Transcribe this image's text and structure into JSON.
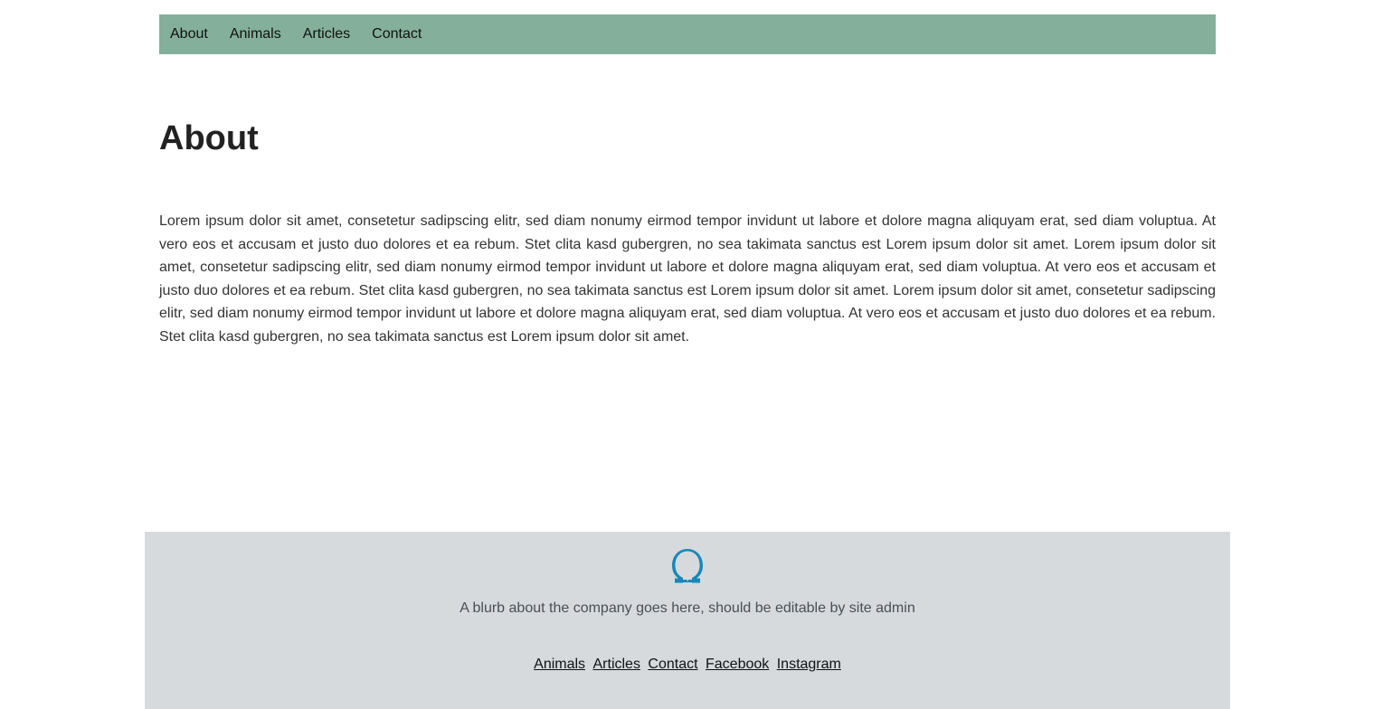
{
  "nav": {
    "items": [
      {
        "label": "About"
      },
      {
        "label": "Animals"
      },
      {
        "label": "Articles"
      },
      {
        "label": "Contact"
      }
    ]
  },
  "main": {
    "title": "About",
    "paragraph": "Lorem ipsum dolor sit amet, consetetur sadipscing elitr, sed diam nonumy eirmod tempor invidunt ut labore et dolore magna aliquyam erat, sed diam voluptua. At vero eos et accusam et justo duo dolores et ea rebum. Stet clita kasd gubergren, no sea takimata sanctus est Lorem ipsum dolor sit amet. Lorem ipsum dolor sit amet, consetetur sadipscing elitr, sed diam nonumy eirmod tempor invidunt ut labore et dolore magna aliquyam erat, sed diam voluptua. At vero eos et accusam et justo duo dolores et ea rebum. Stet clita kasd gubergren, no sea takimata sanctus est Lorem ipsum dolor sit amet. Lorem ipsum dolor sit amet, consetetur sadipscing elitr, sed diam nonumy eirmod tempor invidunt ut labore et dolore magna aliquyam erat, sed diam voluptua. At vero eos et accusam et justo duo dolores et ea rebum. Stet clita kasd gubergren, no sea takimata sanctus est Lorem ipsum dolor sit amet."
  },
  "footer": {
    "logo_icon": "omega-logo-icon",
    "blurb": "A blurb about the company goes here, should be editable by site admin",
    "links": [
      {
        "label": "Animals"
      },
      {
        "label": "Articles"
      },
      {
        "label": "Contact"
      },
      {
        "label": "Facebook"
      },
      {
        "label": "Instagram"
      }
    ]
  },
  "colors": {
    "nav_background": "#84b09b",
    "footer_background": "#d6dadd",
    "logo": "#1a86b8"
  }
}
